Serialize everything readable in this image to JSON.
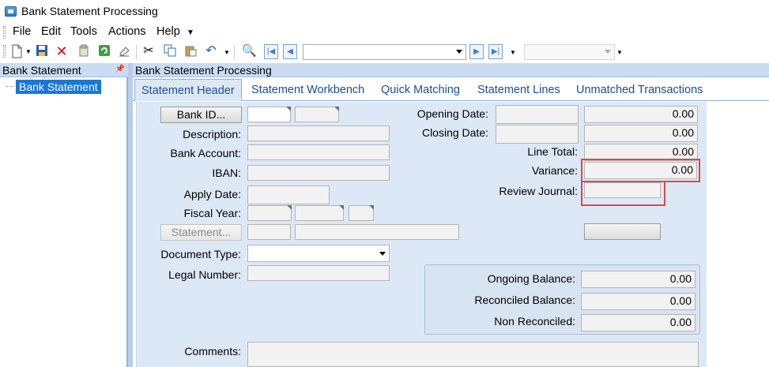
{
  "window": {
    "title": "Bank Statement Processing"
  },
  "menu": [
    "File",
    "Edit",
    "Tools",
    "Actions",
    "Help"
  ],
  "toolbar": {
    "icons": [
      "new-icon",
      "save-icon",
      "delete-icon",
      "attach-icon",
      "refresh-icon",
      "clear-icon",
      "cut-icon",
      "copy-icon",
      "paste-icon",
      "undo-icon",
      "find-icon"
    ],
    "nav": [
      "first-record-icon",
      "previous-record-icon",
      "next-record-icon",
      "last-record-icon"
    ]
  },
  "left_panel": {
    "title": "Bank Statement",
    "tree_items": [
      "Bank Statement"
    ]
  },
  "right_panel": {
    "title": "Bank Statement Processing",
    "tabs": [
      "Statement Header",
      "Statement Workbench",
      "Quick Matching",
      "Statement Lines",
      "Unmatched Transactions"
    ],
    "active_tab": "Statement Header"
  },
  "form": {
    "bank_id_button": "Bank ID...",
    "statement_button": "Statement...",
    "labels": {
      "description": "Description:",
      "bank_account": "Bank Account:",
      "iban": "IBAN:",
      "apply_date": "Apply Date:",
      "fiscal_year": "Fiscal Year:",
      "document_type": "Document Type:",
      "legal_number": "Legal Number:",
      "comments": "Comments:",
      "opening_date": "Opening Date:",
      "closing_date": "Closing Date:",
      "line_total": "Line Total:",
      "variance": "Variance:",
      "review_journal": "Review Journal:",
      "ongoing_balance": "Ongoing Balance:",
      "reconciled_balance": "Reconciled Balance:",
      "non_reconciled": "Non Reconciled:"
    },
    "values": {
      "opening_balance": "0.00",
      "closing_balance": "0.00",
      "line_total": "0.00",
      "variance": "0.00",
      "ongoing_balance": "0.00",
      "reconciled_balance": "0.00",
      "non_reconciled": "0.00"
    }
  },
  "colors": {
    "highlight": "#e0474a",
    "tab_text": "#1a4e9a",
    "panel_bg": "#dde8f6",
    "selection": "#1a77d8"
  }
}
